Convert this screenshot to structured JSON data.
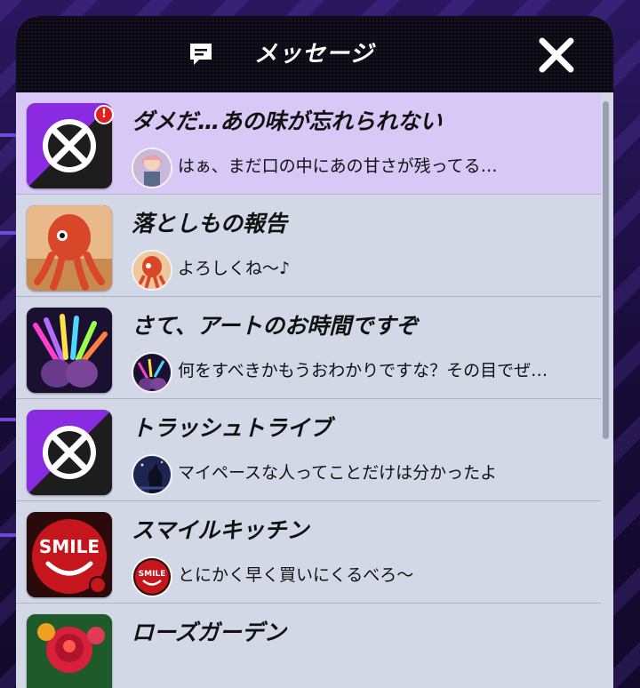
{
  "header": {
    "title": "メッセージ",
    "icon": "message-icon",
    "close_icon": "close-icon"
  },
  "colors": {
    "header_bg": "#0c0a14",
    "list_bg": "#d3d8e6",
    "active_row_bg": "#d8c8f6",
    "badge": "#e02020"
  },
  "messages": [
    {
      "title": "ダメだ…あの味が忘れられない",
      "preview": "はぁ、まだ口の中にあの甘さが残ってる…",
      "icon": "crossed-circle-logo-icon",
      "avatar": "girl-character-avatar",
      "unread_badge": "!",
      "selected": true
    },
    {
      "title": "落としもの報告",
      "preview": "よろしくね～♪",
      "icon": "octopus-character-icon",
      "avatar": "octopus-character-avatar",
      "selected": false
    },
    {
      "title": "さて、アートのお時間ですぞ",
      "preview": "何をすべきかもうおわかりですな？その目でぜ…",
      "icon": "glowsticks-hands-icon",
      "avatar": "glowsticks-hands-avatar",
      "selected": false
    },
    {
      "title": "トラッシュトライブ",
      "preview": "マイペースな人ってことだけは分かったよ",
      "icon": "crossed-circle-logo-icon",
      "avatar": "night-cat-avatar",
      "selected": false
    },
    {
      "title": "スマイルキッチン",
      "preview": "とにかく早く買いにくるべろ～",
      "icon": "smile-kitchen-logo-icon",
      "avatar": "smile-kitchen-avatar",
      "logo_text": "SMILE",
      "selected": false
    },
    {
      "title": "ローズガーデン",
      "preview": "",
      "icon": "rose-icon",
      "selected": false
    }
  ]
}
